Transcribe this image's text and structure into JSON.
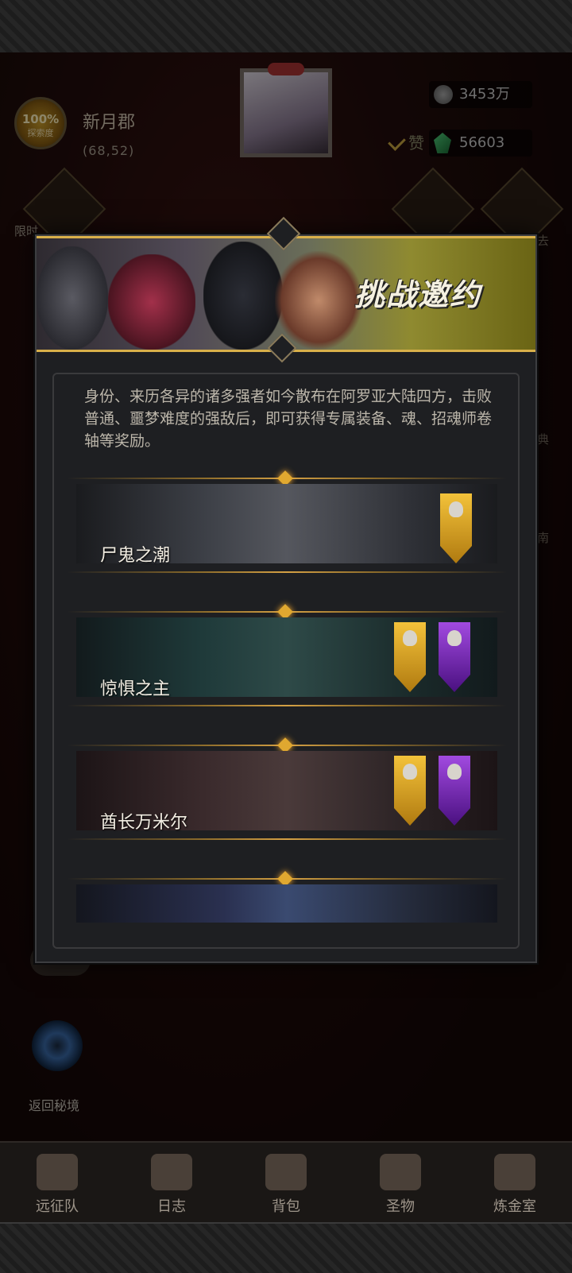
{
  "hud": {
    "explore_percent": "100%",
    "explore_label": "探索度",
    "location_name": "新月郡",
    "location_coords": "(68,52)",
    "silver_amount": "3453万",
    "like_label": "赞",
    "gem_amount": "56603"
  },
  "side": {
    "left_label_partial": "限时",
    "right_edge_labels": [
      "去",
      "典",
      "南"
    ]
  },
  "return_label": "返回秘境",
  "modal": {
    "title": "挑战邀约",
    "intro": "身份、来历各异的诸多强者如今散布在阿罗亚大陆四方，击败普通、噩梦难度的强敌后，即可获得专属装备、魂、招魂师卷轴等奖励。",
    "challenges": [
      {
        "name": "尸鬼之潮",
        "badges": [
          "normal"
        ]
      },
      {
        "name": "惊惧之主",
        "badges": [
          "normal",
          "nightmare"
        ]
      },
      {
        "name": "酋长万米尔",
        "badges": [
          "normal",
          "nightmare"
        ]
      },
      {
        "name": "",
        "badges": []
      }
    ]
  },
  "bottom_nav": [
    {
      "label": "远征队",
      "icon": "helmet-icon"
    },
    {
      "label": "日志",
      "icon": "scroll-icon"
    },
    {
      "label": "背包",
      "icon": "bag-icon"
    },
    {
      "label": "圣物",
      "icon": "chalice-icon"
    },
    {
      "label": "炼金室",
      "icon": "alchemy-icon"
    }
  ],
  "colors": {
    "gold": "#d9b04a",
    "nightmare": "#8a2ad0",
    "panel": "#1e1f22"
  }
}
